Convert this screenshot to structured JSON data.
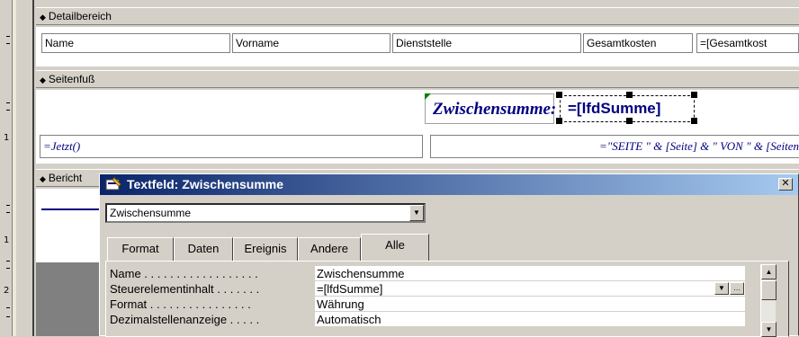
{
  "sections": {
    "detail": "Detailbereich",
    "footer": "Seitenfuß",
    "report": "Bericht"
  },
  "detail_fields": [
    "Name",
    "Vorname",
    "Dienststelle",
    "Gesamtkosten",
    "=[Gesamtkost"
  ],
  "footer": {
    "label": "Zwischensumme:",
    "control": "=[lfdSumme]",
    "date_expr": "=Jetzt()",
    "page_expr": "=\"SEITE \" & [Seite] & \" VON \" & [Seiten"
  },
  "ruler_numbers": [
    "1",
    "1",
    "2"
  ],
  "dialog": {
    "title": "Textfeld: Zwischensumme",
    "close": "✕",
    "combo_value": "Zwischensumme",
    "tabs": [
      "Format",
      "Daten",
      "Ereignis",
      "Andere",
      "Alle"
    ],
    "properties": [
      {
        "label": "Name . . . . . . . . . . . . . . . . . .",
        "value": "Zwischensumme"
      },
      {
        "label": "Steuerelementinhalt . . . . . . .",
        "value": "=[lfdSumme]"
      },
      {
        "label": "Format . . . . . . . . . . . . . . . .",
        "value": "Währung"
      },
      {
        "label": "Dezimalstellenanzeige . . . . .",
        "value": "Automatisch"
      }
    ]
  },
  "colors": {
    "titlebar_start": "#0a246a",
    "titlebar_end": "#a6caf0",
    "label_blue": "#000080"
  }
}
